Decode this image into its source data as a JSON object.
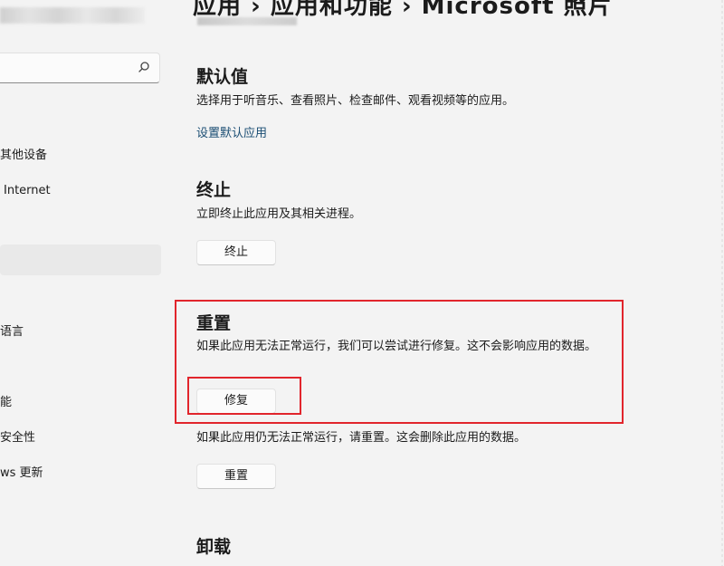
{
  "sidebar": {
    "search": {
      "value": "",
      "placeholder": ""
    },
    "items": [
      {
        "label": "其他设备"
      },
      {
        "label": "Internet"
      },
      {
        "label": ""
      },
      {
        "label": "语言"
      },
      {
        "label": "能"
      },
      {
        "label": "安全性"
      },
      {
        "label": "ws 更新"
      }
    ]
  },
  "header": {
    "breadcrumb": "应用  ›  应用和功能  ›  Microsoft 照片"
  },
  "sections": {
    "defaults": {
      "title": "默认值",
      "description": "选择用于听音乐、查看照片、检查邮件、观看视频等的应用。",
      "link": "设置默认应用"
    },
    "terminate": {
      "title": "终止",
      "description": "立即终止此应用及其相关进程。",
      "button": "终止"
    },
    "reset": {
      "title": "重置",
      "repair_description": "如果此应用无法正常运行，我们可以尝试进行修复。这不会影响应用的数据。",
      "repair_button": "修复",
      "reset_description": "如果此应用仍无法正常运行，请重置。这会删除此应用的数据。",
      "reset_button": "重置"
    },
    "uninstall": {
      "title": "卸载"
    }
  },
  "colors": {
    "highlight": "#e1252c",
    "link": "#1a4d73",
    "background": "#f3f3f3"
  }
}
